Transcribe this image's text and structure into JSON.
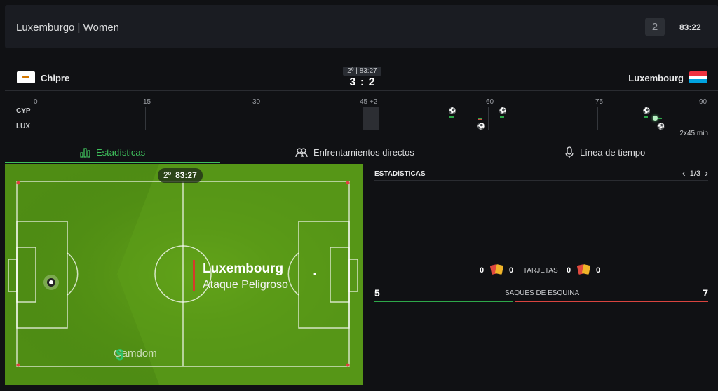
{
  "header": {
    "title": "Luxemburgo | Women",
    "period": "2",
    "clock": "83:22"
  },
  "match": {
    "home": {
      "name": "Chipre",
      "code": "CYP"
    },
    "away": {
      "name": "Luxembourg",
      "code": "LUX"
    },
    "mini_clock": "2º | 83:27",
    "score": "3 : 2"
  },
  "timeline": {
    "ticks": [
      "0",
      "15",
      "30",
      "45 +2",
      "60",
      "75",
      "90"
    ],
    "duration": "2x45 min",
    "progress_minute": 83.3,
    "home_events": [
      {
        "type": "goal",
        "minute": 55
      },
      {
        "type": "goal",
        "minute": 62
      },
      {
        "type": "goal",
        "minute": 82
      }
    ],
    "away_events": [
      {
        "type": "red-card",
        "minute": 59
      },
      {
        "type": "goal",
        "minute": 59
      },
      {
        "type": "goal",
        "minute": 84
      }
    ]
  },
  "tabs": [
    {
      "label": "Estadísticas",
      "icon": "bar-chart-icon",
      "active": true
    },
    {
      "label": "Enfrentamientos directos",
      "icon": "users-icon",
      "active": false
    },
    {
      "label": "Línea de tiempo",
      "icon": "stopwatch-icon",
      "active": false
    }
  ],
  "pitch": {
    "period": "2º",
    "clock": "83:27",
    "attack_team": "Luxembourg",
    "attack_type": "Ataque Peligroso",
    "brand": "Gamdom"
  },
  "stats": {
    "title": "ESTADÍSTICAS",
    "page": "1/3",
    "cards": {
      "label": "TARJETAS",
      "home_red": "0",
      "home_yellow": "0",
      "away_red": "0",
      "away_yellow": "0"
    },
    "corners": {
      "label": "SAQUES DE ESQUINA",
      "home": "5",
      "away": "7"
    }
  },
  "colors": {
    "accent": "#3fbf5c",
    "away": "#d9443f",
    "pitch": "#4f8d14"
  }
}
